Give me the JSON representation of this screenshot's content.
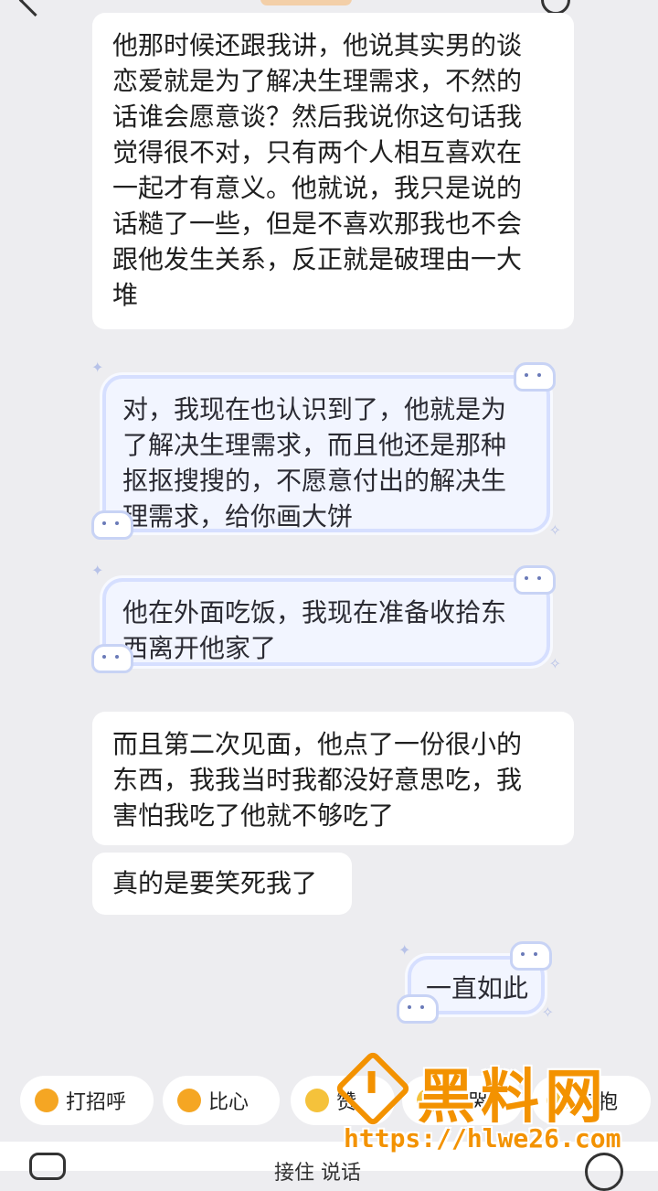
{
  "messages": [
    {
      "side": "left",
      "style": "plain",
      "lines": [
        "他那时候还跟我讲，他说其实男的谈",
        "恋爱就是为了解决生理需求，不然的",
        "话谁会愿意谈？然后我说你这句话我",
        "觉得很不对，只有两个人相互喜欢在",
        "一起才有意义。他就说，我只是说的",
        "话糙了一些，但是不喜欢那我也不会",
        "跟他发生关系，反正就是破理由一大",
        "堆"
      ]
    },
    {
      "side": "left",
      "style": "decorated",
      "lines": [
        "对，我现在也认识到了，他就是为",
        "了解决生理需求，而且他还是那种",
        "抠抠搜搜的，不愿意付出的解决生",
        "理需求，给你画大饼"
      ]
    },
    {
      "side": "left",
      "style": "decorated",
      "lines": [
        "他在外面吃饭，我现在准备收拾东",
        "西离开他家了"
      ]
    },
    {
      "side": "left",
      "style": "plain",
      "lines": [
        "而且第二次见面，他点了一份很小的",
        "东西，我我当时我都没好意思吃，我",
        "害怕我吃了他就不够吃了"
      ]
    },
    {
      "side": "left",
      "style": "plain",
      "lines": [
        "真的是要笑死我了"
      ]
    },
    {
      "side": "right",
      "style": "decorated",
      "lines": [
        "一直如此"
      ]
    }
  ],
  "quick_replies": [
    {
      "label": "打招呼",
      "icon": "hand-wave-icon",
      "color": "#f5a623"
    },
    {
      "label": "比心",
      "icon": "heart-hand-icon",
      "color": "#f5a623"
    },
    {
      "label": "赞",
      "icon": "thumbs-up-icon",
      "color": "#f5c23b"
    },
    {
      "label": "哭哭",
      "icon": "cry-icon",
      "color": "#f5c23b"
    },
    {
      "label": "抱抱",
      "icon": "hug-icon",
      "color": "#f5c23b"
    }
  ],
  "input": {
    "placeholder": "接住 说话"
  },
  "watermark": {
    "title": "黑料网",
    "url": "https://hlwe26.com"
  },
  "colors": {
    "background": "#ededf0",
    "bubble": "#ffffff",
    "deco_fill": "#f2f5ff",
    "deco_border": "#d6dfff",
    "watermark": "#f39200"
  }
}
